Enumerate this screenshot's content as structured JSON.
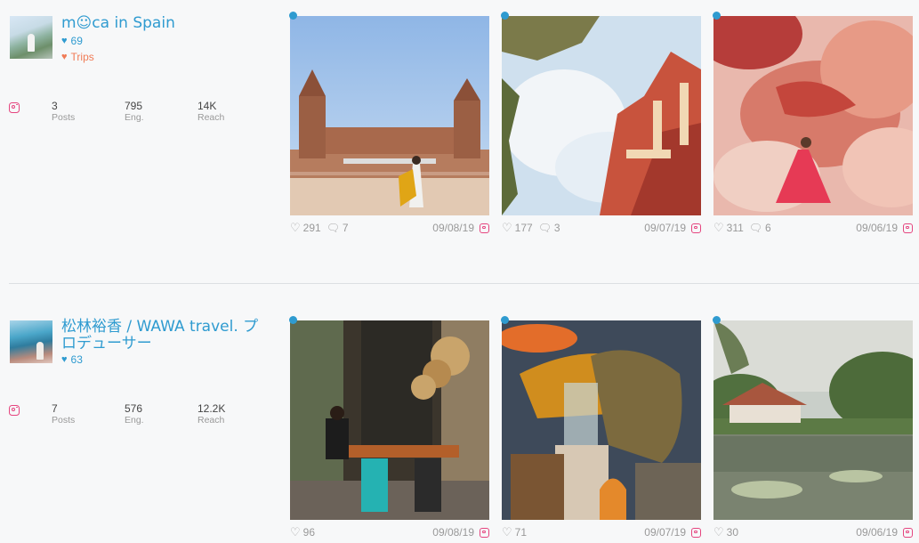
{
  "influencers": [
    {
      "name": "m☺ca in Spain",
      "likes": "69",
      "tag": "Trips",
      "stats": [
        {
          "value": "3",
          "label": "Posts"
        },
        {
          "value": "795",
          "label": "Eng."
        },
        {
          "value": "14K",
          "label": "Reach"
        }
      ],
      "posts": [
        {
          "likes": "291",
          "comments": "7",
          "date": "09/08/19"
        },
        {
          "likes": "177",
          "comments": "3",
          "date": "09/07/19"
        },
        {
          "likes": "311",
          "comments": "6",
          "date": "09/06/19"
        }
      ]
    },
    {
      "name": "松林裕香 / WAWA travel. プロデューサー",
      "likes": "63",
      "stats": [
        {
          "value": "7",
          "label": "Posts"
        },
        {
          "value": "576",
          "label": "Eng."
        },
        {
          "value": "12.2K",
          "label": "Reach"
        }
      ],
      "posts": [
        {
          "likes": "96",
          "date": "09/08/19"
        },
        {
          "likes": "71",
          "date": "09/07/19"
        },
        {
          "likes": "30",
          "date": "09/06/19"
        }
      ]
    }
  ],
  "colors": {
    "accent": "#2f9bd0",
    "tag": "#f07b56",
    "instagram": "#e5457f"
  },
  "icons": [
    "heart-icon",
    "comment-icon",
    "instagram-icon"
  ]
}
